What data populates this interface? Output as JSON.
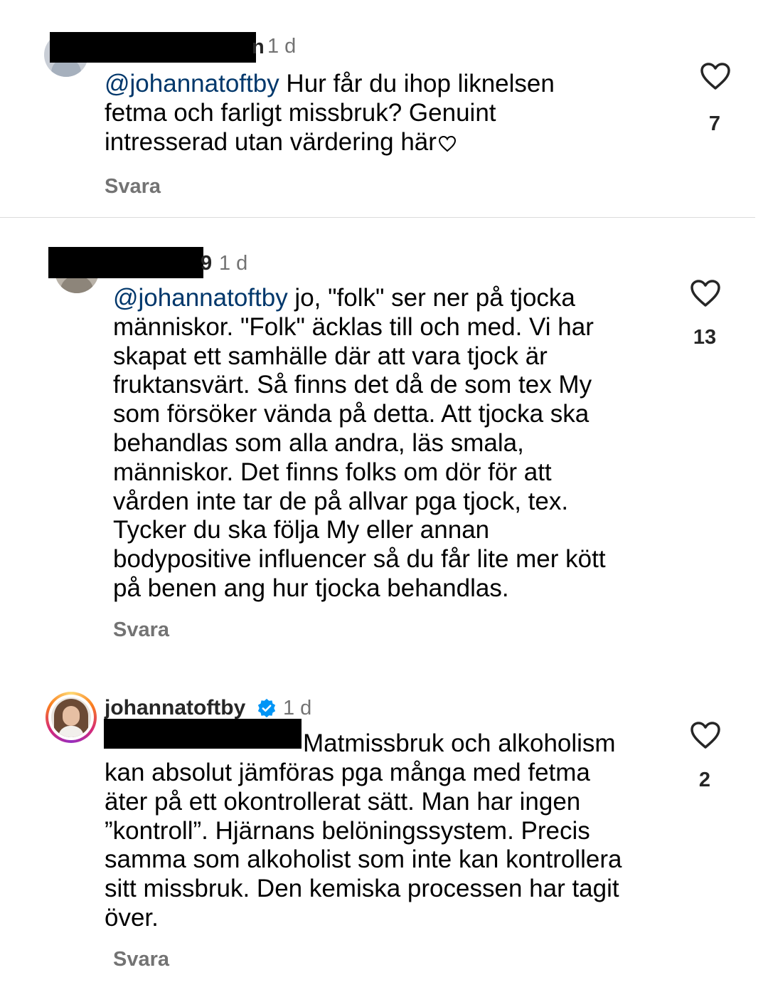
{
  "comments": [
    {
      "time": "1 d",
      "mention": "@johannatoftby",
      "text": " Hur får du ihop liknelsen\nfetma och farligt missbruk? Genuint\nintresserad utan värdering här",
      "reply_label": "Svara",
      "like_count": "7",
      "username_tail": "n"
    },
    {
      "time": "1 d",
      "mention": "@johannatoftby",
      "text": " jo, \"folk\" ser ner på tjocka\nmänniskor. \"Folk\" äcklas till och med. Vi har\nskapat ett samhälle där att vara tjock är\nfruktansvärt. Så finns det då de som tex My\nsom försöker vända på detta. Att tjocka ska\nbehandlas som alla andra, läs smala,\nmänniskor. Det finns folks om dör för att\nvården inte tar de på allvar pga tjock, tex.\nTycker du ska följa My eller annan\nbodypositive influencer så du får lite mer kött\npå benen ang hur tjocka behandlas.",
      "reply_label": "Svara",
      "like_count": "13",
      "username_tail": "9"
    },
    {
      "username": "johannatoftby",
      "time": "1 d",
      "text_first": "Matmissbruk och alkoholism",
      "text": "kan absolut jämföras pga många med fetma\näter på ett okontrollerat sätt. Man har ingen\n”kontroll”. Hjärnans belöningssystem. Precis\nsamma som alkoholist som inte kan kontrollera\nsitt missbruk. Den kemiska processen har tagit\növer.",
      "reply_label": "Svara",
      "like_count": "2"
    }
  ],
  "colors": {
    "mention": "#00376b",
    "meta_gray": "#737373",
    "verified_blue": "#0095f6",
    "divider": "#dbdbdb"
  },
  "icons": [
    "heart-icon",
    "verified-badge-icon",
    "inline-heart-icon"
  ]
}
